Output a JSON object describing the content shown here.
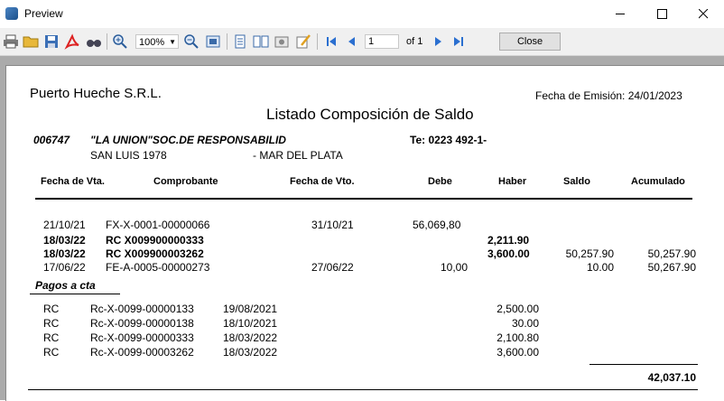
{
  "window": {
    "title": "Preview",
    "minimize_icon": "minimize-icon",
    "maximize_icon": "maximize-icon",
    "close_icon": "close-icon"
  },
  "toolbar": {
    "zoom": "100%",
    "page": "1",
    "of_pages": "of 1",
    "close_label": "Close",
    "icons": [
      "print-icon",
      "open-icon",
      "save-icon",
      "pdf-icon",
      "find-icon",
      "zoom-in-icon",
      "zoom-out-icon",
      "fit-icon",
      "single-page-icon",
      "two-page-icon",
      "settings-icon",
      "edit-icon",
      "first-page-icon",
      "prev-page-icon",
      "next-page-icon",
      "last-page-icon"
    ]
  },
  "report": {
    "company": "Puerto Hueche S.R.L.",
    "emission": "Fecha de Emisión: 24/01/2023",
    "title": "Listado Composición de Saldo",
    "client": {
      "code": "006747",
      "name": "\"LA UNION\"SOC.DE RESPONSABILID",
      "phone": "Te: 0223 492-1-",
      "address": "SAN LUIS 1978",
      "city": "- MAR DEL PLATA"
    },
    "columns": [
      "Fecha de Vta.",
      "Comprobante",
      "Fecha de Vto.",
      "Debe",
      "Haber",
      "Saldo",
      "Acumulado"
    ],
    "rows": [
      {
        "fecha": "21/10/21",
        "comprobante": "FX-X-0001-00000066",
        "vto": "31/10/21",
        "debe": "56,069,80",
        "haber": "",
        "saldo": "",
        "acumulado": "",
        "bold": false
      },
      {
        "fecha": "18/03/22",
        "comprobante": "RC X009900000333",
        "vto": "",
        "debe": "",
        "haber": "2,211.90",
        "saldo": "",
        "acumulado": "",
        "bold": true
      },
      {
        "fecha": "18/03/22",
        "comprobante": "RC X009900003262",
        "vto": "",
        "debe": "",
        "haber": "3,600.00",
        "saldo": "50,257.90",
        "acumulado": "50,257.90",
        "bold": true
      },
      {
        "fecha": "17/06/22",
        "comprobante": "FE-A-0005-00000273",
        "vto": "27/06/22",
        "debe": "10,00",
        "haber": "",
        "saldo": "10.00",
        "acumulado": "50,267.90",
        "bold": false
      }
    ],
    "pagos_label": "Pagos a cta",
    "pagos": [
      {
        "tipo": "RC",
        "comprobante": "Rc-X-0099-00000133",
        "fecha": "19/08/2021",
        "importe": "2,500.00"
      },
      {
        "tipo": "RC",
        "comprobante": "Rc-X-0099-00000138",
        "fecha": "18/10/2021",
        "importe": "30.00"
      },
      {
        "tipo": "RC",
        "comprobante": "Rc-X-0099-00000333",
        "fecha": "18/03/2022",
        "importe": "2,100.80"
      },
      {
        "tipo": "RC",
        "comprobante": "Rc-X-0099-00003262",
        "fecha": "18/03/2022",
        "importe": "3,600.00"
      }
    ],
    "total": "42,037.10"
  }
}
